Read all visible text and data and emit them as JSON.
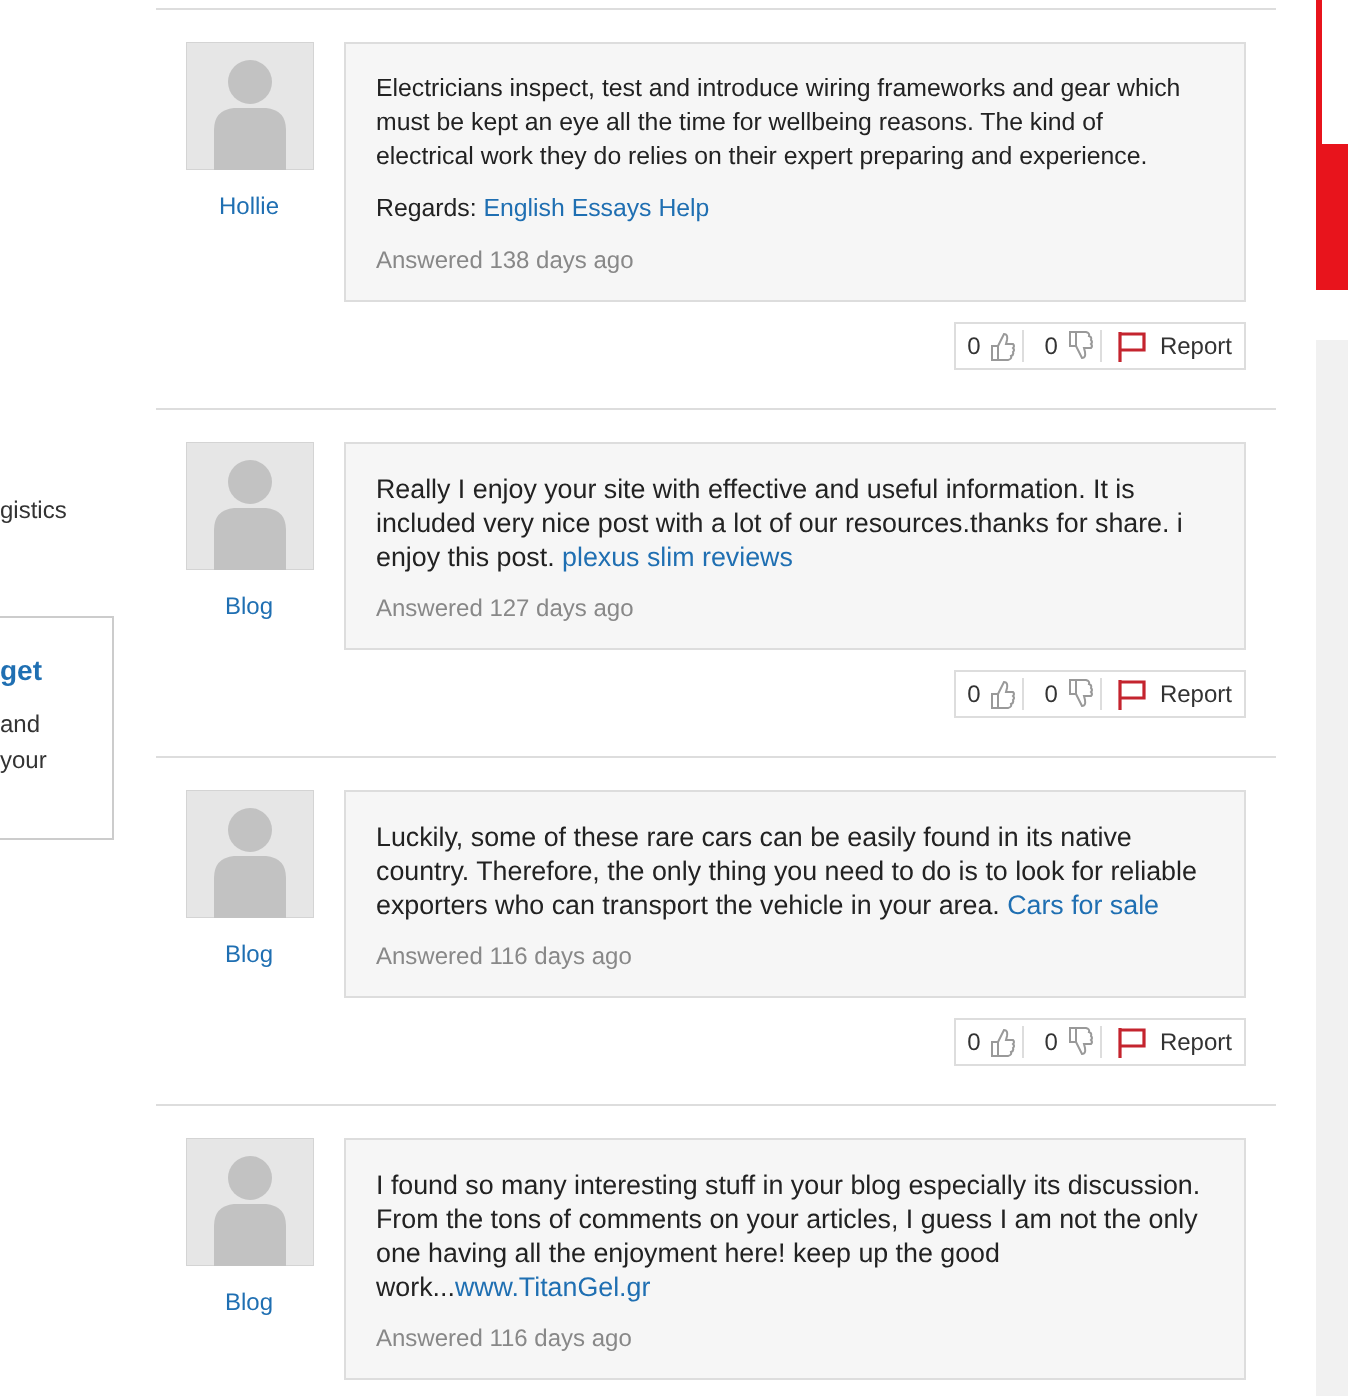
{
  "sidebar": {
    "fragment": "gistics",
    "card": {
      "title": "get",
      "lines": [
        "and",
        "your"
      ]
    }
  },
  "answers": [
    {
      "author": "Hollie",
      "paragraphs": [
        {
          "text": "Electricians inspect, test and introduce wiring frameworks and gear which must be kept an eye all the time for wellbeing reasons. The kind of electrical work they do relies on their expert preparing and experience."
        },
        {
          "text": "Regards: ",
          "link": "English Essays Help"
        }
      ],
      "answered": "Answered 138 days ago",
      "votes": {
        "up": "0",
        "down": "0",
        "report": "Report"
      }
    },
    {
      "author": "Blog",
      "paragraphs": [
        {
          "text": "Really I enjoy your site with effective and useful information. It is included very nice post with a lot of our resources.thanks for share. i enjoy this post. ",
          "link": "plexus slim reviews"
        }
      ],
      "answered": "Answered 127 days ago",
      "votes": {
        "up": "0",
        "down": "0",
        "report": "Report"
      }
    },
    {
      "author": "Blog",
      "paragraphs": [
        {
          "text": "Luckily, some of these rare cars can be easily found in its native country. Therefore, the only thing you need to do is to look for reliable exporters who can transport the vehicle in your area. ",
          "link": "Cars for sale"
        }
      ],
      "answered": "Answered 116 days ago",
      "votes": {
        "up": "0",
        "down": "0",
        "report": "Report"
      }
    },
    {
      "author": "Blog",
      "paragraphs": [
        {
          "text": "I found so many interesting stuff in your blog especially its discussion. From the tons of comments on your articles, I guess I am not the only one having all the enjoyment here! keep up the good work...",
          "link": "www.TitanGel.gr"
        }
      ],
      "answered": "Answered 116 days ago"
    }
  ]
}
